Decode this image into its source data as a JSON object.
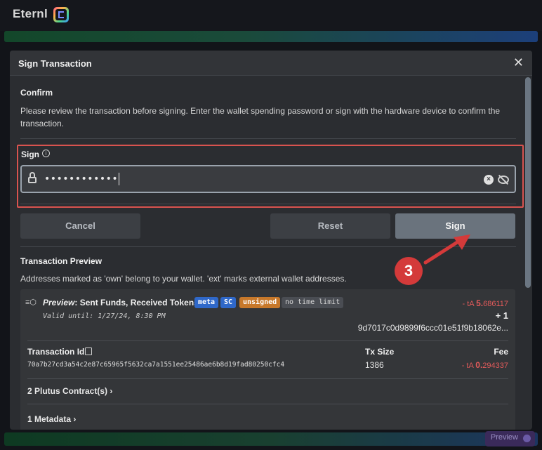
{
  "app": {
    "brand": "Eternl"
  },
  "dialog": {
    "title": "Sign Transaction",
    "close_glyph": "✕",
    "confirm": {
      "heading": "Confirm",
      "text": "Please review the transaction before signing. Enter the wallet spending password or sign with the hardware device to confirm the transaction."
    },
    "sign": {
      "label": "Sign",
      "password_masked": "••••••••••••"
    },
    "buttons": {
      "cancel": "Cancel",
      "reset": "Reset",
      "sign": "Sign"
    },
    "preview": {
      "heading": "Transaction Preview",
      "text": "Addresses marked as 'own' belong to your wallet. 'ext' marks external wallet addresses.",
      "title_prefix": "Preview",
      "title_rest": ": Sent Funds, Received Tokens",
      "badges": [
        "meta",
        "SC",
        "unsigned",
        "no time limit"
      ],
      "valid_until": "Valid until: 1/27/24, 8:30 PM",
      "amount_prefix": "- tA ",
      "amount_whole": "5.",
      "amount_decimals": "686117",
      "token_count": "+ 1",
      "token_id": "9d7017c0d9899f6ccc01e51f9b18062e...",
      "tx_id_label": "Transaction Id",
      "tx_id": "70a7b27cd3a54c2e87c65965f5632ca7a1551ee25486ae6b8d19fad80250cfc4",
      "tx_size_label": "Tx Size",
      "tx_size": "1386",
      "fee_label": "Fee",
      "fee_prefix": "- tA ",
      "fee_whole": "0.",
      "fee_decimals": "294337",
      "plutus": "2 Plutus Contract(s)",
      "metadata": "1 Metadata"
    }
  },
  "annotation": {
    "step": "3"
  },
  "footer": {
    "preview_pill": "Preview"
  },
  "colors": {
    "negative": "#e05a5a",
    "highlight": "#d9534f",
    "badge_blue": "#2f68c9",
    "badge_orange": "#c7782a"
  }
}
